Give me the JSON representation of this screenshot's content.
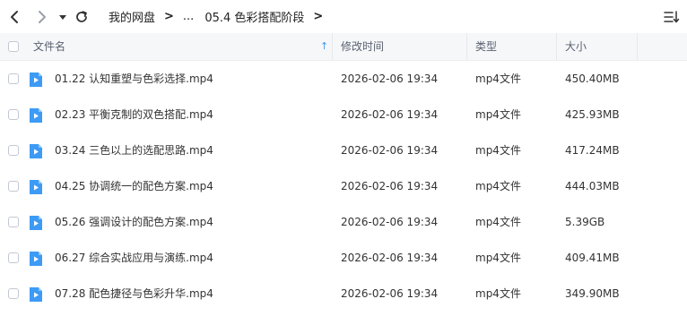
{
  "toolbar": {
    "breadcrumb": [
      {
        "label": "我的网盘"
      },
      {
        "label": "..."
      },
      {
        "label": "05.4 色彩搭配阶段"
      }
    ],
    "icons": [
      "chevron-left-icon",
      "chevron-right-icon",
      "dropdown-icon",
      "refresh-icon",
      "sort-list-icon"
    ]
  },
  "table": {
    "headers": {
      "name": "文件名",
      "modified": "修改时间",
      "type": "类型",
      "size": "大小"
    },
    "sort_indicator": "↑",
    "rows": [
      {
        "name": "01.22 认知重塑与色彩选择.mp4",
        "modified": "2026-02-06 19:34",
        "type": "mp4文件",
        "size": "450.40MB"
      },
      {
        "name": "02.23 平衡克制的双色搭配.mp4",
        "modified": "2026-02-06 19:34",
        "type": "mp4文件",
        "size": "425.93MB"
      },
      {
        "name": "03.24 三色以上的选配思路.mp4",
        "modified": "2026-02-06 19:34",
        "type": "mp4文件",
        "size": "417.24MB"
      },
      {
        "name": "04.25 协调统一的配色方案.mp4",
        "modified": "2026-02-06 19:34",
        "type": "mp4文件",
        "size": "444.03MB"
      },
      {
        "name": "05.26 强调设计的配色方案.mp4",
        "modified": "2026-02-06 19:34",
        "type": "mp4文件",
        "size": "5.39GB"
      },
      {
        "name": "06.27 综合实战应用与演练.mp4",
        "modified": "2026-02-06 19:34",
        "type": "mp4文件",
        "size": "409.41MB"
      },
      {
        "name": "07.28 配色捷径与色彩升华.mp4",
        "modified": "2026-02-06 19:34",
        "type": "mp4文件",
        "size": "349.90MB"
      }
    ]
  },
  "colors": {
    "accent": "#3d9bf5",
    "header_bg": "#f6f7f9"
  }
}
